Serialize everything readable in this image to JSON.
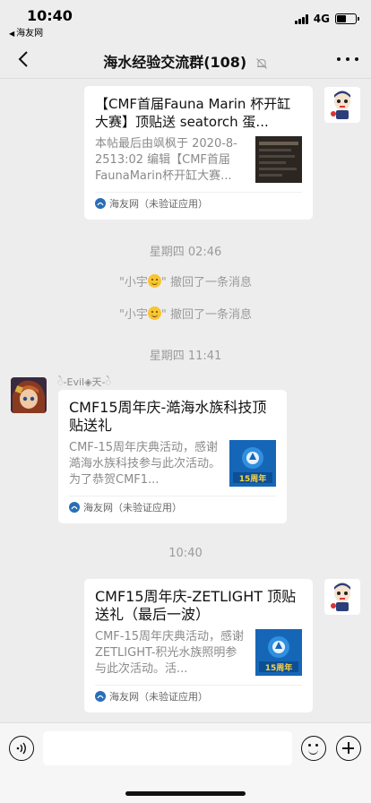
{
  "status_bar": {
    "time": "10:40",
    "back_app": "海友网",
    "network": "4G",
    "battery_level": 0.5
  },
  "nav": {
    "title": "海水经验交流群(108)",
    "icons": [
      "back-arrow-icon",
      "mute-bell-icon",
      "more-icon"
    ]
  },
  "messages": {
    "card1": {
      "title": "【CMF首届Fauna Marin 杯开缸大赛】顶贴送 seatorch 蛋...",
      "desc": "本帖最后由飒枫于 2020-8-2513:02 编辑【CMF首届FaunaMarin杯开缸大赛...",
      "source": "海友网（未验证应用）"
    },
    "time1": "星期四 02:46",
    "recall1": {
      "name": "\"小宇",
      "text": "\" 撤回了一条消息"
    },
    "recall2": {
      "name": "\"小宇",
      "text": "\" 撤回了一条消息"
    },
    "time2": "星期四 11:41",
    "sender2": "ᬂ-Evil◈天-ᬂ",
    "card2": {
      "title": "CMF15周年庆-澔海水族科技顶贴送礼",
      "desc": "CMF-15周年庆典活动，感谢澔海水族科技参与此次活动。为了恭贺CMF1...",
      "source": "海友网（未验证应用）",
      "thumb_label": "15周年"
    },
    "time3": "10:40",
    "card3": {
      "title": "CMF15周年庆-ZETLIGHT 顶贴送礼（最后一波）",
      "desc": "CMF-15周年庆典活动，感谢 ZETLIGHT-积光水族照明参与此次活动。活...",
      "source": "海友网（未验证应用）",
      "thumb_label": "15周年"
    }
  },
  "input_bar": {
    "placeholder": "",
    "icons": [
      "voice-icon",
      "emoji-icon",
      "plus-icon"
    ]
  },
  "colors": {
    "background": "#ededed",
    "card": "#ffffff",
    "meta_text": "#9b9b9b"
  }
}
